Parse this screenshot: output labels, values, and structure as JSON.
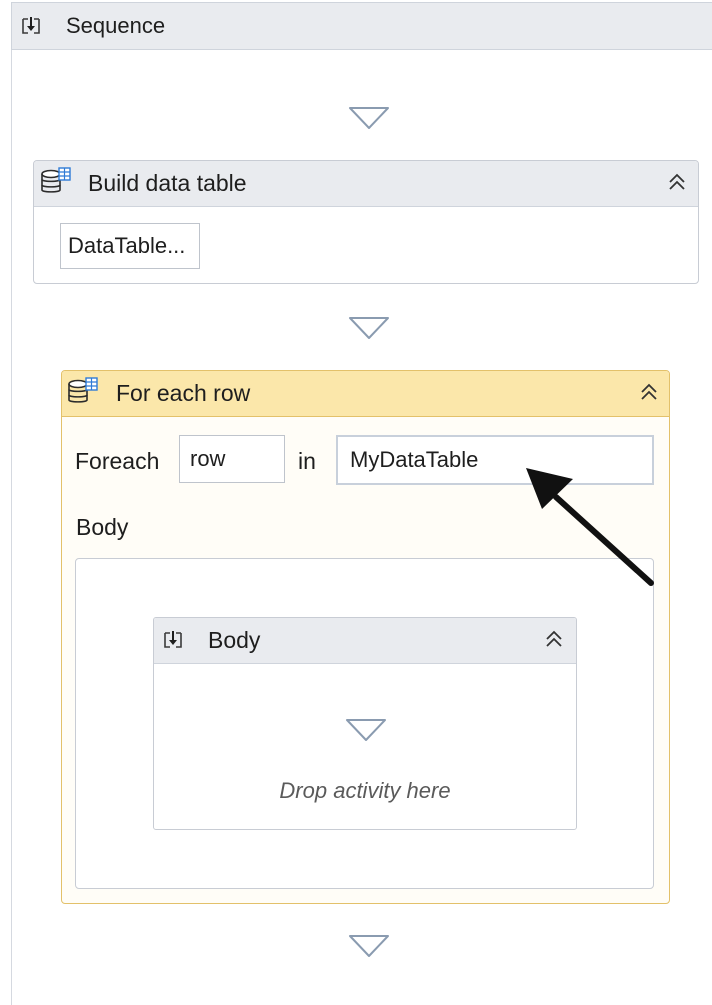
{
  "sequence": {
    "title": "Sequence",
    "icon": "sequence-icon"
  },
  "build_data_table": {
    "title": "Build data table",
    "icon": "data-table-icon",
    "button_label": "DataTable..."
  },
  "for_each_row": {
    "title": "For each row",
    "icon": "data-table-icon",
    "foreach_label": "Foreach",
    "item_value": "row",
    "in_label": "in",
    "collection_value": "MyDataTable",
    "body_label": "Body"
  },
  "body_sequence": {
    "title": "Body",
    "icon": "sequence-icon",
    "drop_hint": "Drop activity here"
  },
  "colors": {
    "header_gray": "#e9ebef",
    "highlight_header": "#fbe7aa",
    "highlight_border": "#e3c16a",
    "drop_triangle": "#8a9bb0"
  }
}
